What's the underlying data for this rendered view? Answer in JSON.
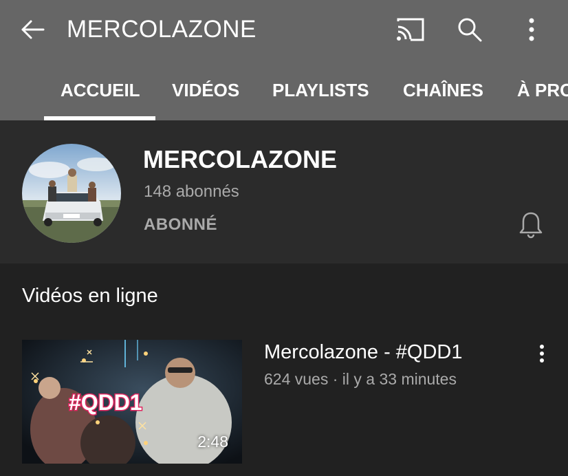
{
  "header": {
    "title": "MERCOLAZONE",
    "icons": [
      "back-arrow-icon",
      "cast-icon",
      "search-icon",
      "more-vert-icon"
    ]
  },
  "tabs": [
    {
      "label": "ACCUEIL",
      "active": true
    },
    {
      "label": "VIDÉOS"
    },
    {
      "label": "PLAYLISTS"
    },
    {
      "label": "CHAÎNES"
    },
    {
      "label": "À PROPOS"
    }
  ],
  "channel": {
    "name": "MERCOLAZONE",
    "subscribers": "148 abonnés",
    "subscription_status": "ABONNÉ"
  },
  "section": {
    "title": "Vidéos en ligne"
  },
  "videos": [
    {
      "title": "Mercolazone - #QDD1",
      "meta": "624 vues · il y a 33 minutes",
      "duration": "2:48",
      "thumbnail_text": "#QDD1"
    }
  ],
  "colors": {
    "topbar": "#666666",
    "background": "#212121",
    "channel_band": "#2b2b2b",
    "secondary_text": "#aaaaaa",
    "thumbnail_tag": "#e0245e"
  }
}
